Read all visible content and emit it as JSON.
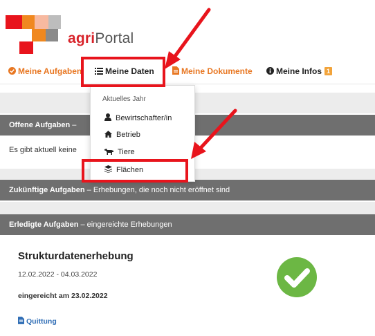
{
  "logo": {
    "brand_bold": "agri",
    "brand_rest": "Portal"
  },
  "nav": {
    "items": [
      {
        "label": "Meine Aufgaben",
        "icon": "check-circle-icon"
      },
      {
        "label": "Meine Daten",
        "icon": "list-icon"
      },
      {
        "label": "Meine Dokumente",
        "icon": "document-icon"
      },
      {
        "label": "Meine Infos",
        "icon": "info-icon",
        "badge": "1"
      }
    ]
  },
  "dropdown": {
    "header": "Aktuelles Jahr",
    "items": [
      {
        "label": "Bewirtschafter/in",
        "icon": "person-icon"
      },
      {
        "label": "Betrieb",
        "icon": "home-icon"
      },
      {
        "label": "Tiere",
        "icon": "cow-icon"
      },
      {
        "label": "Flächen",
        "icon": "layers-icon"
      }
    ]
  },
  "sections": {
    "open": {
      "title": "Offene Aufgaben",
      "suffix": " –",
      "body": "Es gibt aktuell keine"
    },
    "future": {
      "title": "Zukünftige Aufgaben",
      "suffix": " – Erhebungen, die noch nicht eröffnet sind"
    },
    "done": {
      "title": "Erledigte Aufgaben",
      "suffix": " – eingereichte Erhebungen"
    }
  },
  "card": {
    "title": "Strukturdatenerhebung",
    "dates": "12.02.2022 - 04.03.2022",
    "submitted": "eingereicht am 23.02.2022",
    "link": "Quittung"
  },
  "colors": {
    "accent_orange": "#e87722",
    "brand_red": "#d8232a",
    "bar_gray": "#6f6f6f",
    "check_green": "#6cb744",
    "annotation_red": "#e8141c"
  }
}
